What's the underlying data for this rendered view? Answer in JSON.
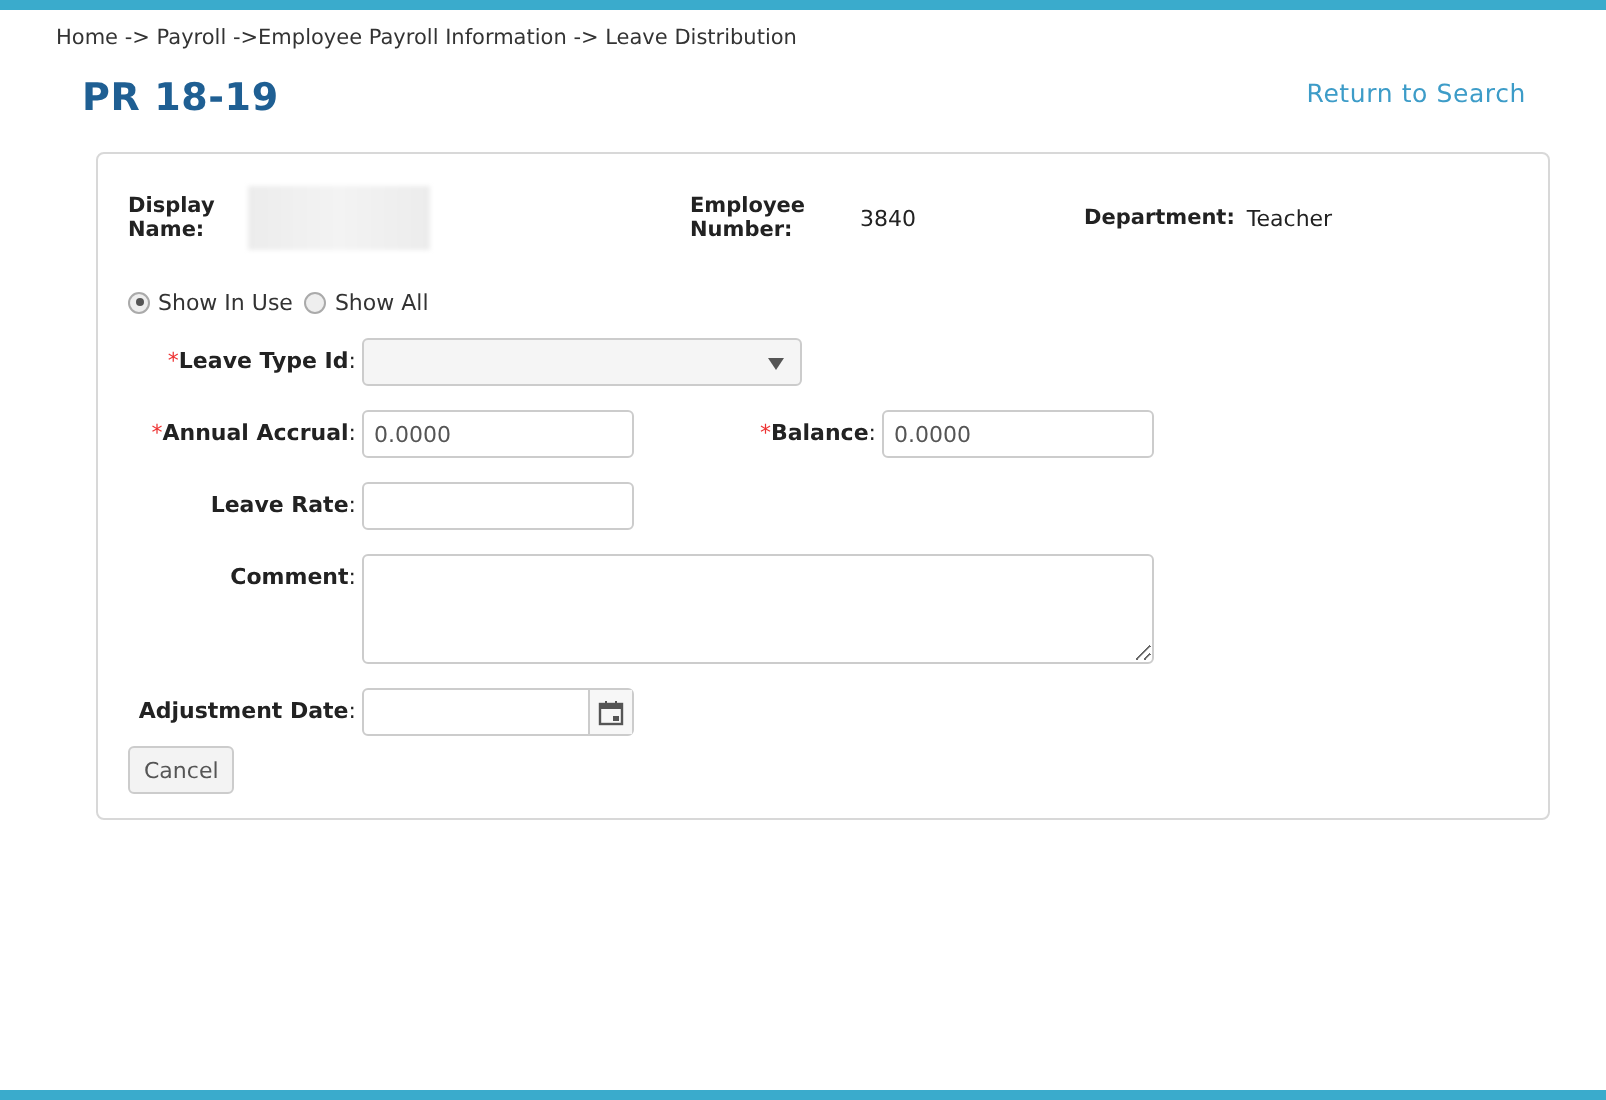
{
  "breadcrumb": "Home -> Payroll ->Employee Payroll Information -> Leave Distribution",
  "title": "PR 18-19",
  "return_link": "Return to Search",
  "header": [
    {
      "label": "Display Name:",
      "kind": "blurred"
    },
    {
      "label": "Employee Number:",
      "value": "3840",
      "kind": "text"
    },
    {
      "label": "Department:",
      "value": "Teacher",
      "kind": "text"
    }
  ],
  "filter": [
    {
      "label": "Show In Use",
      "selected": true
    },
    {
      "label": "Show All",
      "selected": false
    }
  ],
  "fields": [
    {
      "kind": "select",
      "label": "**Leave Type Id**:",
      "marker": "*"
    },
    {
      "kind": "input",
      "label": "**Annual Accrual**:",
      "marker": "*",
      "value": "0.0000"
    },
    {
      "kind": "input",
      "label": "**Balance**:",
      "marker": "*",
      "value": "0.0000"
    },
    {
      "kind": "input",
      "label": "**Leave Rate**:"
    },
    {
      "kind": "textarea",
      "label": "**Comment**:"
    },
    {
      "kind": "date",
      "label": "**Adjustment Date**:"
    }
  ],
  "buttons": [
    "Cancel"
  ]
}
